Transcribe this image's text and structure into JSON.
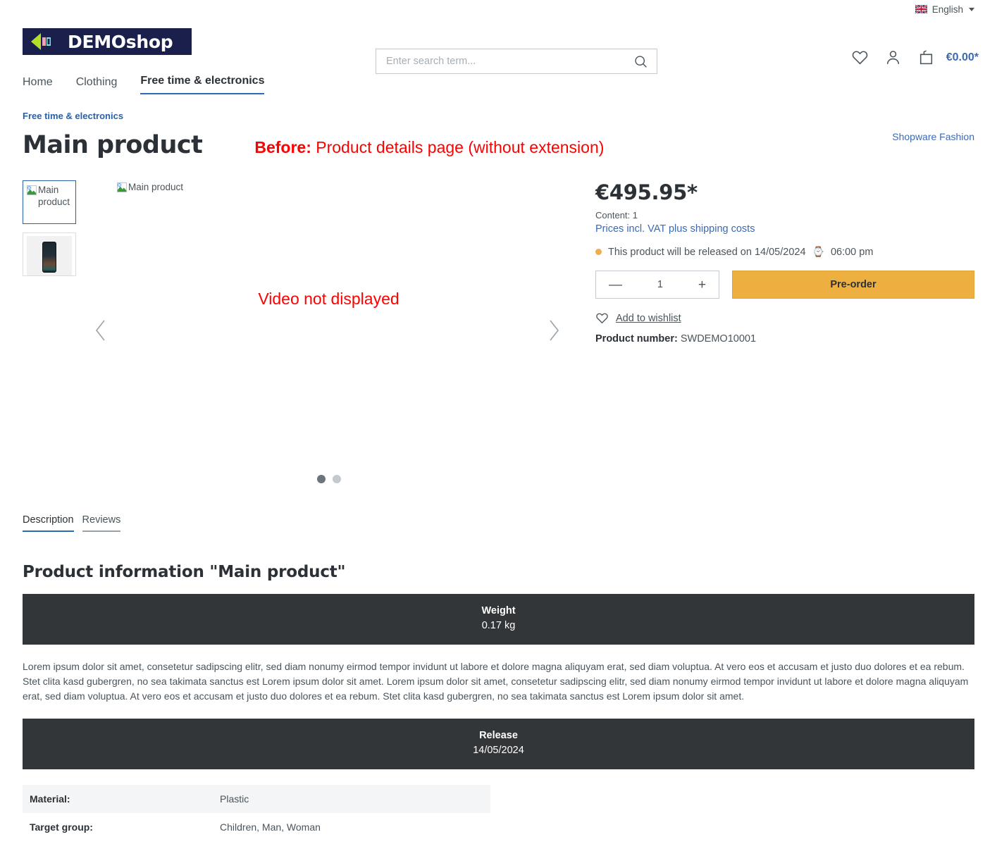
{
  "topbar": {
    "language": "English",
    "flag_icon": "uk-flag-icon",
    "caret_icon": "chevron-down-icon"
  },
  "header": {
    "logo_text": "DEMOshop",
    "logo_bg": "#1b1f4b",
    "search": {
      "placeholder": "Enter search term...",
      "value": "",
      "icon": "search-icon"
    },
    "actions": {
      "wishlist_icon": "heart-icon",
      "account_icon": "user-icon",
      "cart_icon": "bag-icon",
      "cart_total": "€0.00*"
    }
  },
  "nav": {
    "items": [
      {
        "label": "Home",
        "active": false
      },
      {
        "label": "Clothing",
        "active": false
      },
      {
        "label": "Free time & electronics",
        "active": true
      }
    ]
  },
  "breadcrumb": {
    "label": "Free time & electronics"
  },
  "page": {
    "title": "Main product",
    "annotation_bold": "Before:",
    "annotation_rest": " Product details page (without extension)",
    "manufacturer": "Shopware Fashion",
    "annotation_color": "#ff0000"
  },
  "gallery": {
    "thumbnails": [
      {
        "alt": "Main product",
        "broken": true,
        "active": true
      },
      {
        "alt": "Main product",
        "broken": false,
        "active": false
      }
    ],
    "main_alt": "Main product",
    "video_note": "Video not displayed",
    "prev_icon": "chevron-left-icon",
    "next_icon": "chevron-right-icon",
    "dots": [
      {
        "active": true
      },
      {
        "active": false
      }
    ]
  },
  "buybox": {
    "price": "€495.95*",
    "content": "Content: 1",
    "tax_note": "Prices incl. VAT plus shipping costs",
    "delivery_text": "This product will be released on 14/05/2024",
    "delivery_time": "06:00 pm",
    "delivery_bullet_color": "#f0ad4e",
    "watch_icon": "watch-icon",
    "quantity": "1",
    "minus_label": "—",
    "plus_label": "+",
    "cta_label": "Pre-order",
    "cta_color": "#eeaf41",
    "wishlist_label": "Add to wishlist",
    "wishlist_icon": "heart-icon",
    "product_number_label": "Product number:",
    "product_number": "SWDEMO10001"
  },
  "tabs": [
    {
      "label": "Description",
      "active": true
    },
    {
      "label": "Reviews",
      "active": false
    }
  ],
  "description": {
    "heading": "Product information \"Main product\"",
    "weight_band": {
      "title": "Weight",
      "value": "0.17 kg"
    },
    "text": "Lorem ipsum dolor sit amet, consetetur sadipscing elitr, sed diam nonumy eirmod tempor invidunt ut labore et dolore magna aliquyam erat, sed diam voluptua. At vero eos et accusam et justo duo dolores et ea rebum. Stet clita kasd gubergren, no sea takimata sanctus est Lorem ipsum dolor sit amet. Lorem ipsum dolor sit amet, consetetur sadipscing elitr, sed diam nonumy eirmod tempor invidunt ut labore et dolore magna aliquyam erat, sed diam voluptua. At vero eos et accusam et justo duo dolores et ea rebum. Stet clita kasd gubergren, no sea takimata sanctus est Lorem ipsum dolor sit amet.",
    "release_band": {
      "title": "Release",
      "value": "14/05/2024"
    },
    "properties": [
      {
        "key": "Material:",
        "value": "Plastic"
      },
      {
        "key": "Target group:",
        "value": "Children, Man, Woman"
      }
    ]
  }
}
